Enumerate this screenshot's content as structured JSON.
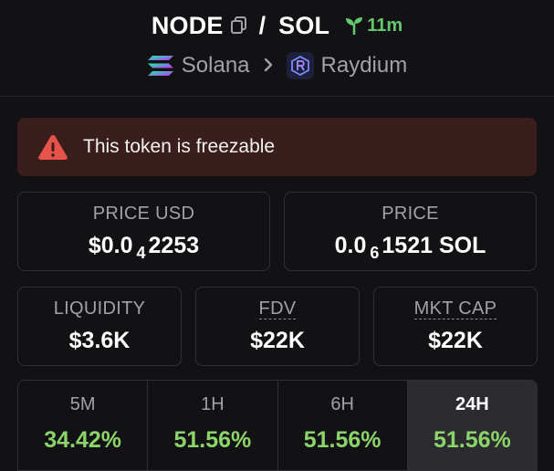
{
  "pair": {
    "base": "NODE",
    "separator": "/",
    "quote": "SOL",
    "age": "11m"
  },
  "breadcrumb": {
    "chain": "Solana",
    "dex": "Raydium"
  },
  "warning": {
    "text": "This token is freezable"
  },
  "price_usd": {
    "label": "PRICE USD",
    "prefix": "$0.0",
    "zeros": "4",
    "digits": "2253"
  },
  "price_native": {
    "label": "PRICE",
    "prefix": "0.0",
    "zeros": "6",
    "digits": "1521",
    "unit": "SOL"
  },
  "stats": {
    "liquidity": {
      "label": "LIQUIDITY",
      "value": "$3.6K"
    },
    "fdv": {
      "label": "FDV",
      "value": "$22K"
    },
    "mkt_cap": {
      "label": "MKT CAP",
      "value": "$22K"
    }
  },
  "timeframes": [
    {
      "label": "5M",
      "value": "34.42%"
    },
    {
      "label": "1H",
      "value": "51.56%"
    },
    {
      "label": "6H",
      "value": "51.56%"
    },
    {
      "label": "24H",
      "value": "51.56%",
      "active": true
    }
  ],
  "colors": {
    "positive": "#8bd46a",
    "age": "#63c96c",
    "warning_bg": "#3a1d1d",
    "warning_icon": "#e5534b"
  },
  "icons": {
    "copy": "copy-icon",
    "age": "seedling-icon",
    "chain": "solana-logo-icon",
    "dex": "raydium-logo-icon",
    "warning": "warning-triangle-icon",
    "separator": "chevron-right-icon"
  }
}
